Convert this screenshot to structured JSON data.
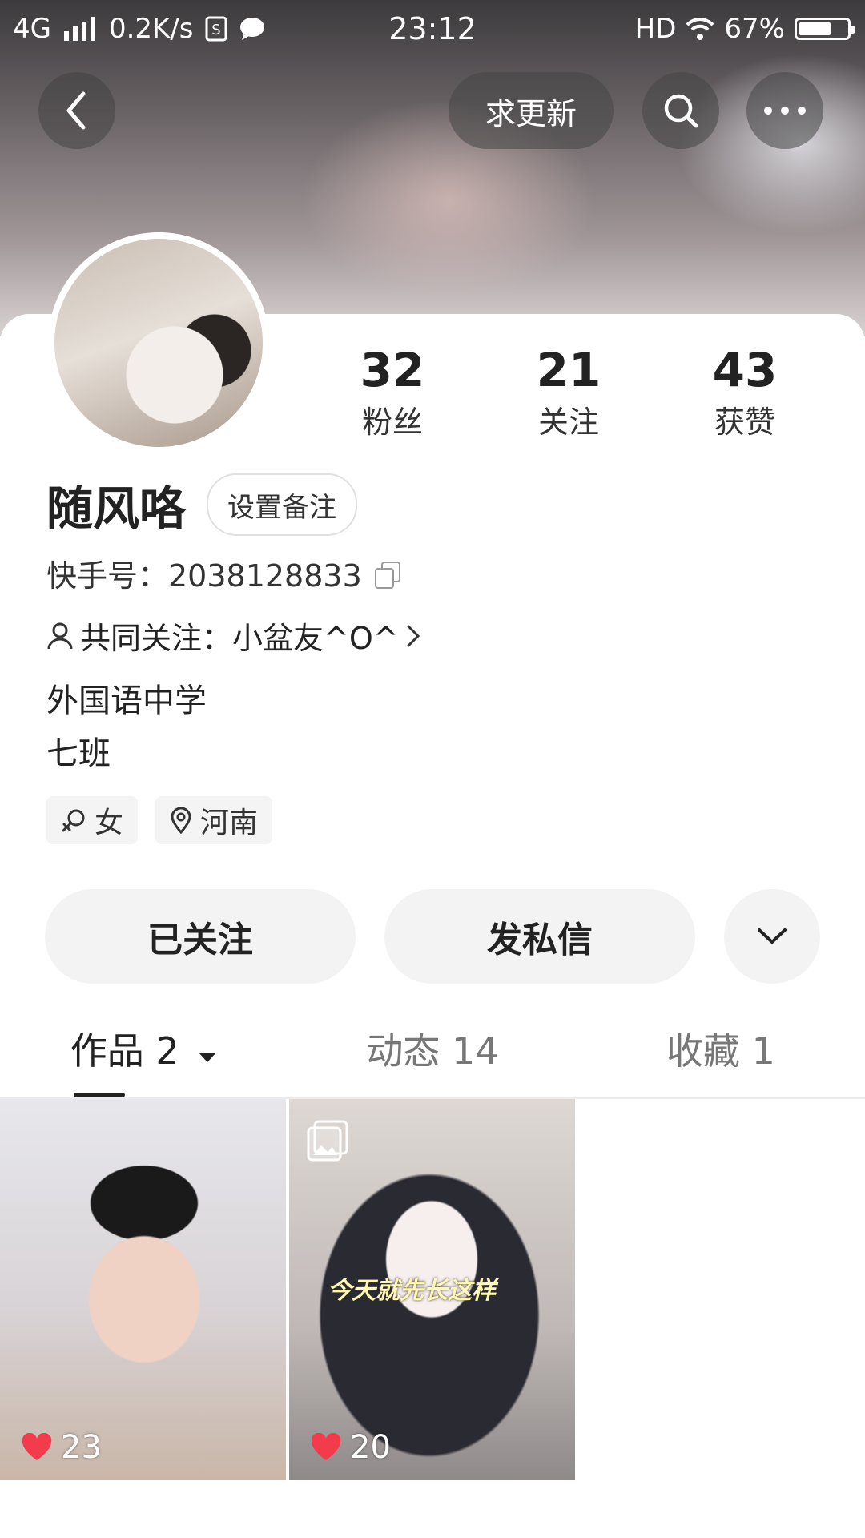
{
  "status_bar": {
    "network": "4G",
    "speed": "0.2K/s",
    "time": "23:12",
    "hd": "HD",
    "battery": "67%",
    "battery_level": 0.67
  },
  "header": {
    "update_button": "求更新",
    "icons": [
      "back-icon",
      "search-icon",
      "more-icon"
    ]
  },
  "profile": {
    "stats": [
      {
        "value": "32",
        "label": "粉丝"
      },
      {
        "value": "21",
        "label": "关注"
      },
      {
        "value": "43",
        "label": "获赞"
      }
    ],
    "name": "随风咯",
    "remark_button": "设置备注",
    "id_text": "快手号：2038128833",
    "mutual_text": "共同关注：小盆友^O^",
    "bio_line1": "外国语中学",
    "bio_line2": "七班",
    "tags": [
      {
        "icon": "female-icon",
        "label": "女"
      },
      {
        "icon": "location-icon",
        "label": "河南"
      }
    ]
  },
  "actions": {
    "following": "已关注",
    "message": "发私信"
  },
  "tabs": [
    {
      "label": "作品 2",
      "active": true
    },
    {
      "label": "动态 14",
      "active": false
    },
    {
      "label": "收藏 1",
      "active": false
    }
  ],
  "works": [
    {
      "likes": "23",
      "caption": ""
    },
    {
      "likes": "20",
      "caption": "今天就先长这样"
    }
  ],
  "colors": {
    "heart": "#f23c4c",
    "tab_active": "#222222",
    "tab_inactive": "#777777",
    "button_bg": "#f3f3f3"
  }
}
